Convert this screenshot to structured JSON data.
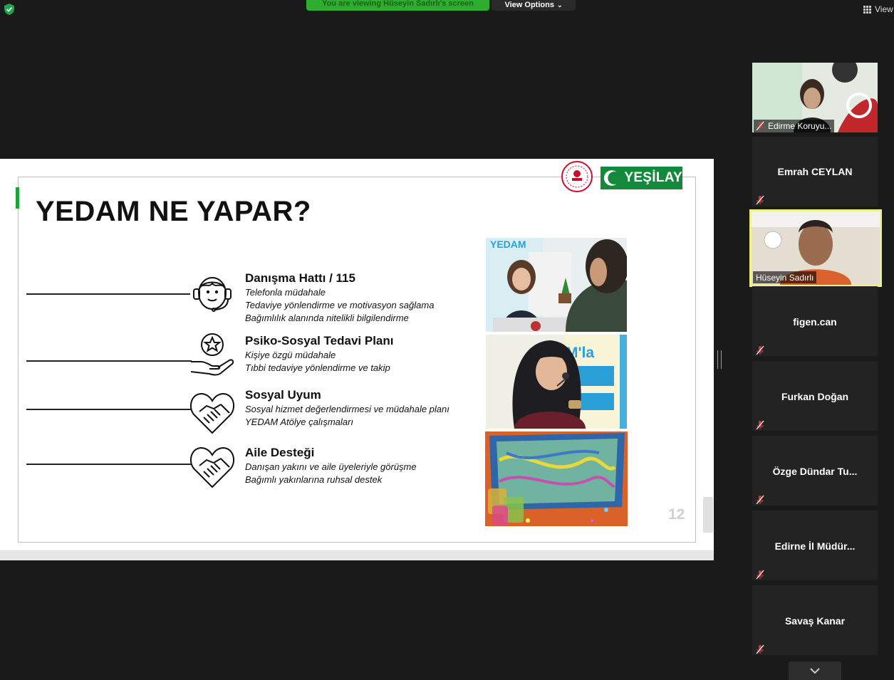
{
  "topbar": {
    "banner": "You are viewing Hüseyin Sadırlı's screen",
    "view_options": "View Options",
    "view": "View"
  },
  "slide": {
    "title": "YEDAM NE YAPAR?",
    "logo_text": "YEŞİLAY",
    "page_number": "12",
    "items": [
      {
        "title": "Danışma Hattı / 115",
        "lines": [
          "Telefonla müdahale",
          "Tedaviye yönlendirme ve motivasyon sağlama",
          "Bağımlılık alanında nitelikli bilgilendirme"
        ]
      },
      {
        "title": "Psiko-Sosyal Tedavi Planı",
        "lines": [
          "Kişiye özgü müdahale",
          "Tıbbi tedaviye yönlendirme ve takip"
        ]
      },
      {
        "title": "Sosyal Uyum",
        "lines": [
          "Sosyal hizmet değerlendirmesi  ve müdahale planı",
          "YEDAM Atölye çalışmaları"
        ]
      },
      {
        "title": "Aile Desteği",
        "lines": [
          "Danışan yakını ve aile üyeleriyle görüşme",
          "Bağımlı yakınlarına ruhsal destek"
        ]
      }
    ],
    "photo1_text": "YEDAM",
    "photo2_text": "M'la"
  },
  "participants": [
    {
      "name": "Edirme Koruyu...",
      "video": true
    },
    {
      "name": "Emrah CEYLAN",
      "video": false
    },
    {
      "name": "Hüseyin Sadırlı",
      "video": true,
      "active": true
    },
    {
      "name": "figen.can",
      "video": false
    },
    {
      "name": "Furkan Doğan",
      "video": false
    },
    {
      "name": "Özge Dündar Tu...",
      "video": false
    },
    {
      "name": "Edirne İl Müdür...",
      "video": false
    },
    {
      "name": "Savaş Kanar",
      "video": false
    }
  ],
  "colors": {
    "banner": "#2eae2e",
    "active_border": "#f0f08a",
    "yesilay_green": "#138a3b",
    "muted_icon": "#d23a3a"
  }
}
